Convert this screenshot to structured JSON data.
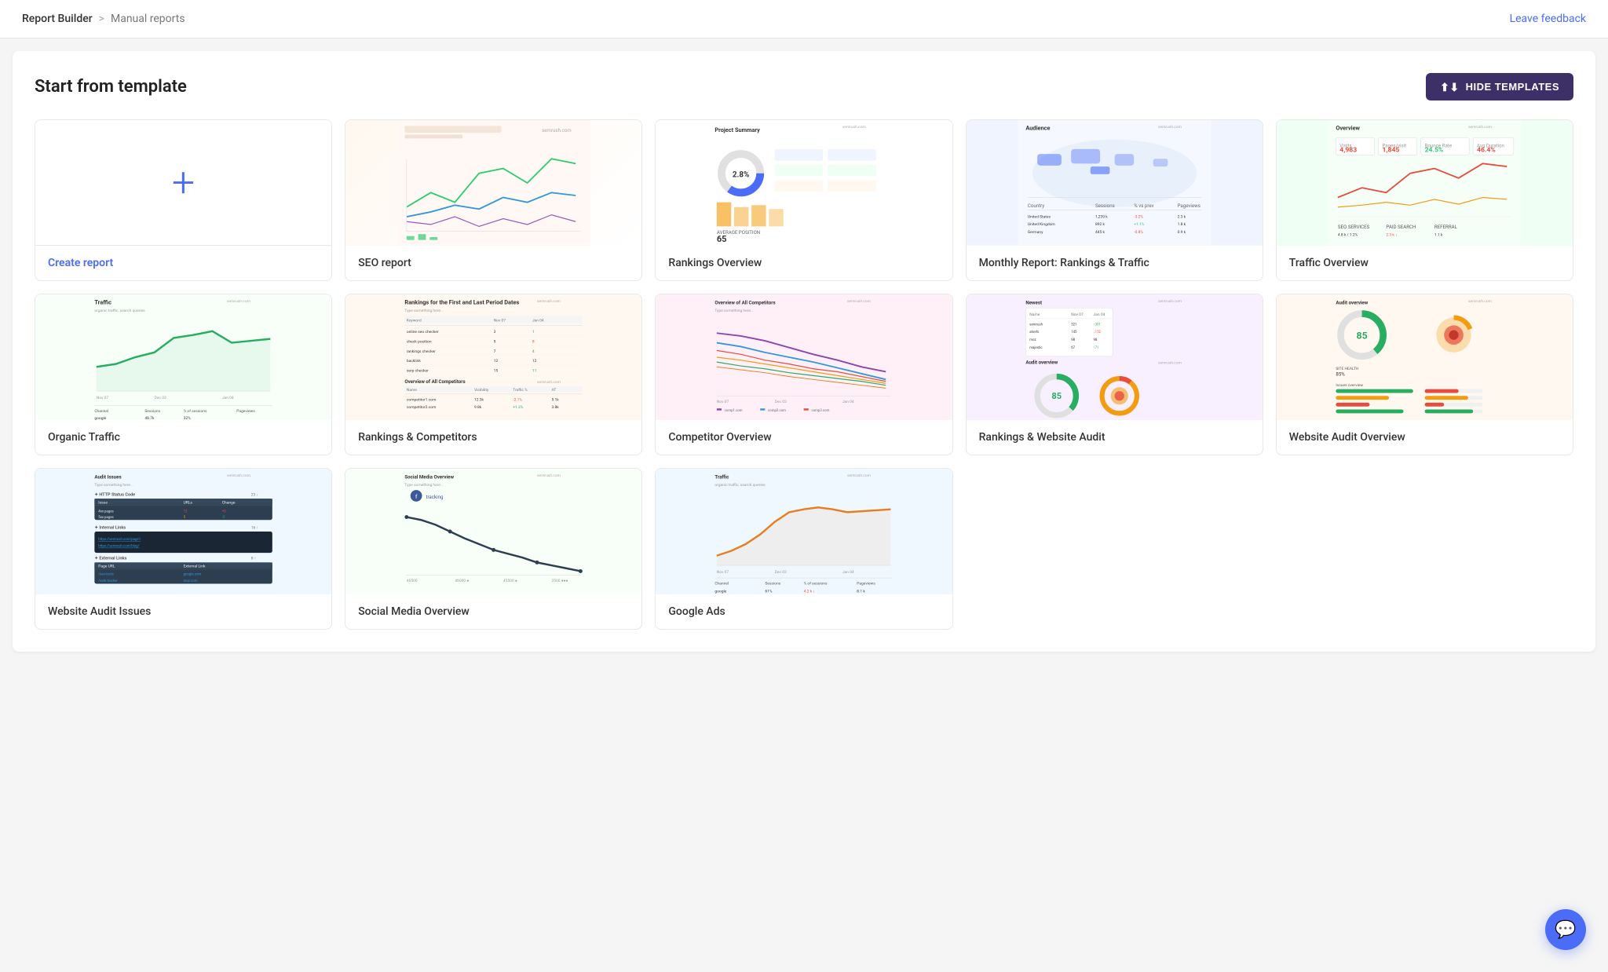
{
  "nav": {
    "breadcrumb_main": "Report Builder",
    "breadcrumb_separator": ">",
    "breadcrumb_current": "Manual reports",
    "leave_feedback": "Leave feedback"
  },
  "section": {
    "title": "Start from template",
    "hide_templates_btn": "HIDE TEMPLATES"
  },
  "templates": [
    {
      "id": "create",
      "label": "Create report",
      "type": "create"
    },
    {
      "id": "seo-report",
      "label": "SEO report",
      "type": "chart-lines"
    },
    {
      "id": "rankings-overview",
      "label": "Rankings Overview",
      "type": "dashboard-mixed"
    },
    {
      "id": "monthly-report",
      "label": "Monthly Report: Rankings & Traffic",
      "type": "world-map"
    },
    {
      "id": "traffic-overview",
      "label": "Traffic Overview",
      "type": "multi-line"
    },
    {
      "id": "organic-traffic",
      "label": "Organic Traffic",
      "type": "single-line"
    },
    {
      "id": "rankings-competitors",
      "label": "Rankings & Competitors",
      "type": "table-chart"
    },
    {
      "id": "competitor-overview",
      "label": "Competitor Overview",
      "type": "multi-line-2"
    },
    {
      "id": "rankings-website-audit",
      "label": "Rankings & Website Audit",
      "type": "audit-gauges"
    },
    {
      "id": "website-audit-overview",
      "label": "Website Audit Overview",
      "type": "audit-bars"
    },
    {
      "id": "website-audit-issues",
      "label": "Website Audit Issues",
      "type": "issues-table"
    },
    {
      "id": "social-media-overview",
      "label": "Social Media Overview",
      "type": "social-line"
    },
    {
      "id": "google-ads",
      "label": "Google Ads",
      "type": "ads-line"
    }
  ]
}
